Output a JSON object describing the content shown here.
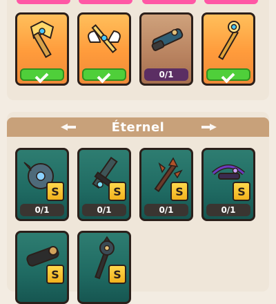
{
  "section": {
    "title": "Éternel"
  },
  "top_cards": [
    {
      "name": "golden-axe",
      "status": "done",
      "label": ""
    },
    {
      "name": "winged-sword",
      "status": "done",
      "label": ""
    },
    {
      "name": "cannon",
      "status": "count",
      "label": "0/1"
    },
    {
      "name": "golden-scepter",
      "status": "done",
      "label": ""
    }
  ],
  "eternal_cards": [
    {
      "name": "spiked-shield",
      "label": "0/1",
      "rank": "S"
    },
    {
      "name": "dark-blade",
      "label": "0/1",
      "rank": "S"
    },
    {
      "name": "thorn-staff",
      "label": "0/1",
      "rank": "S"
    },
    {
      "name": "crossbow",
      "label": "0/1",
      "rank": "S"
    },
    {
      "name": "heavy-cannon",
      "label": "",
      "rank": "S"
    },
    {
      "name": "spiked-mace",
      "label": "",
      "rank": "S"
    }
  ],
  "colors": {
    "legend": "#ff9b3b",
    "eternal": "#1f6a62",
    "done": "#4fcf3a",
    "header": "#c8a17a"
  },
  "icons": [
    "check-icon",
    "arrow-left-icon",
    "arrow-right-icon",
    "s-rank-badge"
  ]
}
